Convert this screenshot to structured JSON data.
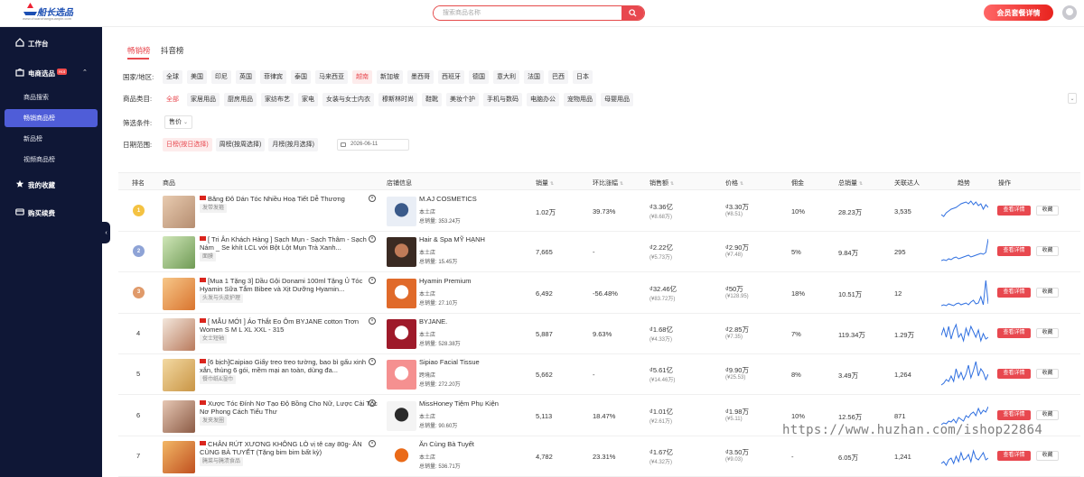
{
  "brand": {
    "logo_text": "船长选品",
    "logo_sub": "www.chuanzhangxuanpin.com"
  },
  "header": {
    "search_placeholder": "搜索商品名称",
    "vip_button": "会员套餐详情"
  },
  "sidebar": {
    "items": [
      {
        "label": "工作台",
        "icon": "dashboard-icon"
      },
      {
        "label": "电商选品",
        "icon": "shop-icon",
        "badge": "Hot"
      },
      {
        "label": "我的收藏",
        "icon": "star-icon"
      },
      {
        "label": "购买续费",
        "icon": "card-icon"
      }
    ],
    "subitems": [
      "商品搜索",
      "畅销商品榜",
      "新品榜",
      "视频商品榜"
    ],
    "active_subitem": "畅销商品榜"
  },
  "tabs": [
    "畅销榜",
    "抖音榜"
  ],
  "filters": {
    "country_label": "国家/地区:",
    "countries": [
      "全球",
      "美国",
      "印尼",
      "英国",
      "菲律宾",
      "泰国",
      "马来西亚",
      "越南",
      "新加坡",
      "墨西哥",
      "西班牙",
      "德国",
      "意大利",
      "法国",
      "巴西",
      "日本"
    ],
    "selected_country": "越南",
    "category_label": "商品类目:",
    "categories": [
      "全部",
      "家居用品",
      "厨房用品",
      "家纺布艺",
      "家电",
      "女装与女士内衣",
      "穆斯林时尚",
      "鞋靴",
      "美妆个护",
      "手机与数码",
      "电脑办公",
      "宠物用品",
      "母婴用品"
    ],
    "selected_category": "全部",
    "condition_label": "筛选条件:",
    "condition_value": "售价",
    "date_label": "日期范围:",
    "date_options": [
      "日榜(按日选择)",
      "周榜(按周选择)",
      "月榜(按月选择)"
    ],
    "selected_date_option": "日榜(按日选择)",
    "date_value": "2026-06-11"
  },
  "table": {
    "headers": [
      "排名",
      "商品",
      "店铺信息",
      "销量",
      "环比涨幅",
      "销售额",
      "价格",
      "佣金",
      "总销量",
      "关联达人",
      "趋势",
      "操作"
    ],
    "detail_label": "查看详情",
    "fav_label": "收藏",
    "rows": [
      {
        "rank": "1",
        "medal": "gold",
        "title": "Băng Đô Dán Tóc Nhiều Hoạ Tiết Dễ Thương",
        "tag": "发带发箍",
        "shop": "M.AJ COSMETICS",
        "shop_type": "本土店",
        "shop_total": "总销量: 353.24万",
        "sales": "1.02万",
        "growth": "39.73%",
        "revenue": "₫3.36亿",
        "revenue_cny": "(¥8.68万)",
        "price": "₫3.30万",
        "price_cny": "(¥8.51)",
        "commission": "10%",
        "total_sales": "28.23万",
        "influencers": "3,535",
        "trend": [
          20,
          22,
          18,
          16,
          14,
          13,
          12,
          10,
          8,
          7,
          6,
          8,
          5,
          9,
          6,
          10,
          8,
          14,
          9,
          12
        ]
      },
      {
        "rank": "2",
        "medal": "silver",
        "title": "[ Tri Ân Khách Hàng ] Sạch Mụn - Sạch Thâm - Sạch Nám _ Se khít LCL với Bột Lột Mụn Trà Xanh...",
        "tag": "面膜",
        "shop": "Hair & Spa MỸ HẠNH",
        "shop_type": "本土店",
        "shop_total": "总销量: 15.45万",
        "sales": "7,665",
        "growth": "-",
        "revenue": "₫2.22亿",
        "revenue_cny": "(¥5.73万)",
        "price": "₫2.90万",
        "price_cny": "(¥7.48)",
        "commission": "5%",
        "total_sales": "9.84万",
        "influencers": "295",
        "trend": [
          26,
          25,
          26,
          24,
          25,
          23,
          22,
          24,
          23,
          22,
          21,
          20,
          22,
          21,
          20,
          19,
          18,
          19,
          17,
          2
        ]
      },
      {
        "rank": "3",
        "medal": "bronze",
        "title": "[Mua 1 Tặng 3] Dầu Gội Donami 100ml Tặng Ủ Tóc Hyamin Sữa Tắm Bibee và Xịt Dưỡng Hyamin...",
        "tag": "头发与头皮护理",
        "shop": "Hyamin Premium",
        "shop_type": "本土店",
        "shop_total": "总销量: 27.10万",
        "sales": "6,492",
        "growth": "-56.48%",
        "revenue": "₫32.46亿",
        "revenue_cny": "(¥83.72万)",
        "price": "₫50万",
        "price_cny": "(¥128.95)",
        "commission": "18%",
        "total_sales": "10.51万",
        "influencers": "12",
        "trend": [
          30,
          29,
          30,
          28,
          29,
          30,
          28,
          27,
          29,
          28,
          27,
          29,
          26,
          24,
          28,
          27,
          20,
          29,
          2,
          28
        ]
      },
      {
        "rank": "4",
        "medal": "",
        "title": "[ MẪU MỚI ] Áo Thắt Eo Ôm BYJANE cotton Trơn Women S M L XL XXL - 315",
        "tag": "女士短袖",
        "shop": "BYJANE.",
        "shop_type": "本土店",
        "shop_total": "总销量: 528.38万",
        "sales": "5,887",
        "growth": "9.63%",
        "revenue": "₫1.68亿",
        "revenue_cny": "(¥4.33万)",
        "price": "₫2.85万",
        "price_cny": "(¥7.35)",
        "commission": "7%",
        "total_sales": "119.34万",
        "influencers": "1.29万",
        "trend": [
          18,
          10,
          20,
          8,
          22,
          12,
          6,
          20,
          16,
          24,
          10,
          18,
          8,
          14,
          20,
          12,
          24,
          16,
          22,
          20
        ]
      },
      {
        "rank": "5",
        "medal": "",
        "title": "[6 bịch]Caipiao Giấy treo treo tường, bao bì gấu xinh xắn, thùng 6 gói, mềm mại an toàn, dùng đa...",
        "tag": "餐巾纸&湿巾",
        "shop": "Sipiao Facial Tissue",
        "shop_type": "跨境店",
        "shop_total": "总销量: 272.20万",
        "sales": "5,662",
        "growth": "-",
        "revenue": "₫5.61亿",
        "revenue_cny": "(¥14.46万)",
        "price": "₫9.90万",
        "price_cny": "(¥25.53)",
        "commission": "8%",
        "total_sales": "3.49万",
        "influencers": "1,264",
        "trend": [
          28,
          26,
          22,
          24,
          18,
          24,
          10,
          20,
          14,
          22,
          16,
          6,
          20,
          12,
          2,
          18,
          10,
          14,
          22,
          16
        ]
      },
      {
        "rank": "6",
        "medal": "",
        "title": "Xược Tóc Đính Nơ Tạo Độ Bồng Cho Nữ, Lược Cài Tóc Nơ Phong Cách Tiểu Thư",
        "tag": "发夹发圈",
        "shop": "MissHoney Tiệm Phụ Kiện",
        "shop_type": "本土店",
        "shop_total": "总销量: 90.60万",
        "sales": "5,113",
        "growth": "18.47%",
        "revenue": "₫1.01亿",
        "revenue_cny": "(¥2.61万)",
        "price": "₫1.98万",
        "price_cny": "(¥5.11)",
        "commission": "10%",
        "total_sales": "12.56万",
        "influencers": "871",
        "trend": [
          26,
          24,
          25,
          22,
          23,
          20,
          24,
          18,
          20,
          22,
          16,
          18,
          14,
          12,
          16,
          8,
          14,
          10,
          12,
          6
        ]
      },
      {
        "rank": "7",
        "medal": "",
        "title": "CHÂN RÚT XƯƠNG KHÔNG LÒ vị tê cay 80g- ĂN CÙNG BÀ TUYẾT (Tặng bim bim bất kỳ)",
        "tag": "腌菜与腌渍食品",
        "shop": "Ăn Cùng Bà Tuyết",
        "shop_type": "本土店",
        "shop_total": "总销量: 536.71万",
        "sales": "4,782",
        "growth": "23.31%",
        "revenue": "₫1.67亿",
        "revenue_cny": "(¥4.32万)",
        "price": "₫3.50万",
        "price_cny": "(¥9.03)",
        "commission": "-",
        "total_sales": "6.05万",
        "influencers": "1,241",
        "trend": [
          24,
          22,
          26,
          20,
          18,
          24,
          16,
          22,
          12,
          20,
          18,
          14,
          22,
          10,
          18,
          20,
          16,
          12,
          20,
          18
        ]
      }
    ]
  },
  "watermark": "https://www.huzhan.com/ishop22864",
  "colors": {
    "accent": "#e8484f",
    "sidebar_bg": "#0f1736",
    "sidebar_active": "#4f5dd8",
    "trend_line": "#2f6fe0"
  }
}
